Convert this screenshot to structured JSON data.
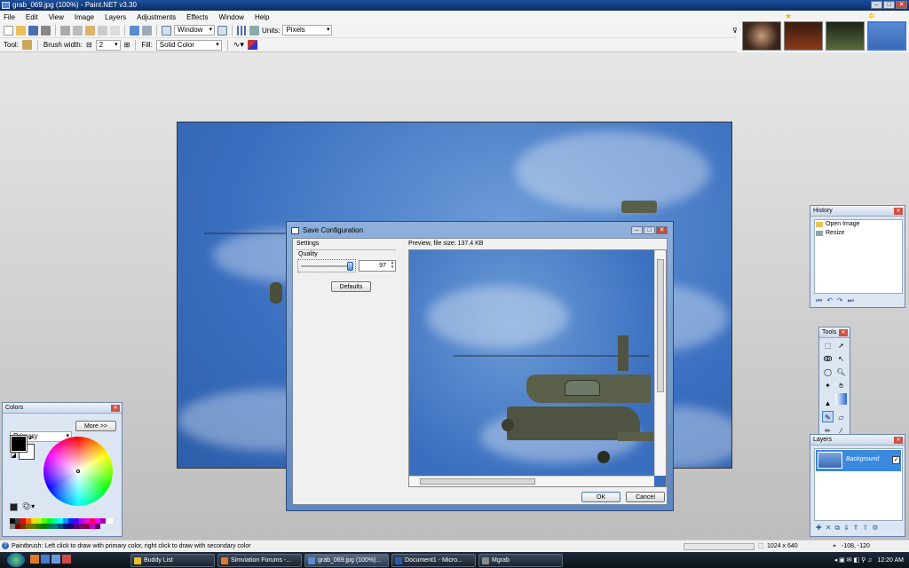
{
  "window": {
    "title": "grab_069.jpg (100%) - Paint.NET v3.30"
  },
  "menu": [
    "File",
    "Edit",
    "View",
    "Image",
    "Layers",
    "Adjustments",
    "Effects",
    "Window",
    "Help"
  ],
  "toolbar1": {
    "zoom_mode": "Window",
    "units_label": "Units:",
    "units_value": "Pixels"
  },
  "toolbar2": {
    "tool_label": "Tool:",
    "brush_width_label": "Brush width:",
    "brush_width_value": "2",
    "fill_label": "Fill:",
    "fill_value": "Solid Color"
  },
  "dialog": {
    "title": "Save Configuration",
    "settings_label": "Settings",
    "quality_label": "Quality",
    "quality_value": "97",
    "quality_fraction": 0.97,
    "defaults_label": "Defaults",
    "preview_label": "Preview, file size: 137.4 KB",
    "ok_label": "OK",
    "cancel_label": "Cancel"
  },
  "history": {
    "title": "History",
    "items": [
      "Open Image",
      "Resize"
    ]
  },
  "tools": {
    "title": "Tools"
  },
  "layers": {
    "title": "Layers",
    "items": [
      {
        "name": "Background",
        "checked": true
      }
    ]
  },
  "colors": {
    "title": "Colors",
    "mode": "Primary",
    "more_label": "More >>",
    "primary": "#000000",
    "secondary": "#ffffff"
  },
  "status": {
    "hint": "Paintbrush: Left click to draw with primary color, right click to draw with secondary color",
    "size": "1024 x 640",
    "coords": "-108, -120"
  },
  "taskbar": {
    "items": [
      "Buddy List",
      "Simviation Forums -...",
      "grab_069.jpg (100%)...",
      "Document1 - Micro...",
      "Mgrab"
    ],
    "clock": "12:20 AM"
  }
}
